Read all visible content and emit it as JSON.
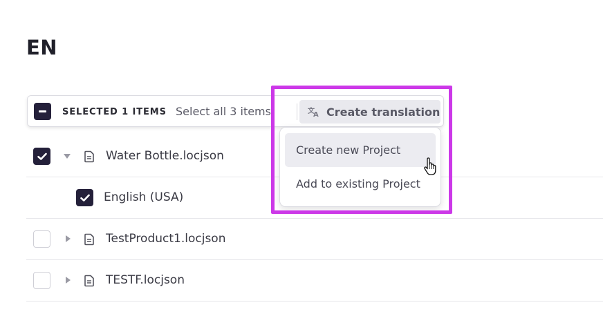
{
  "page": {
    "title": "EN"
  },
  "toolbar": {
    "selected_label": "SELECTED 1 ITEMS",
    "select_all_label": "Select all 3 items",
    "create_translation_label": "Create translation",
    "translate_icon": "translate-icon"
  },
  "dropdown": {
    "items": [
      {
        "label": "Create new Project",
        "hovered": true
      },
      {
        "label": "Add to existing Project",
        "hovered": false
      }
    ]
  },
  "tree": {
    "rows": [
      {
        "label": "Water Bottle.locjson",
        "checked": true,
        "expanded": true,
        "icon": "file-icon"
      },
      {
        "label": "English (USA)",
        "checked": true,
        "child": true
      },
      {
        "label": "TestProduct1.locjson",
        "checked": false,
        "expanded": false,
        "icon": "file-icon"
      },
      {
        "label": "TESTF.locjson",
        "checked": false,
        "expanded": false,
        "icon": "file-icon"
      }
    ]
  },
  "colors": {
    "accent_dark": "#24203a",
    "highlight_border": "#cc38e8",
    "hover_bg": "#ececf1"
  }
}
